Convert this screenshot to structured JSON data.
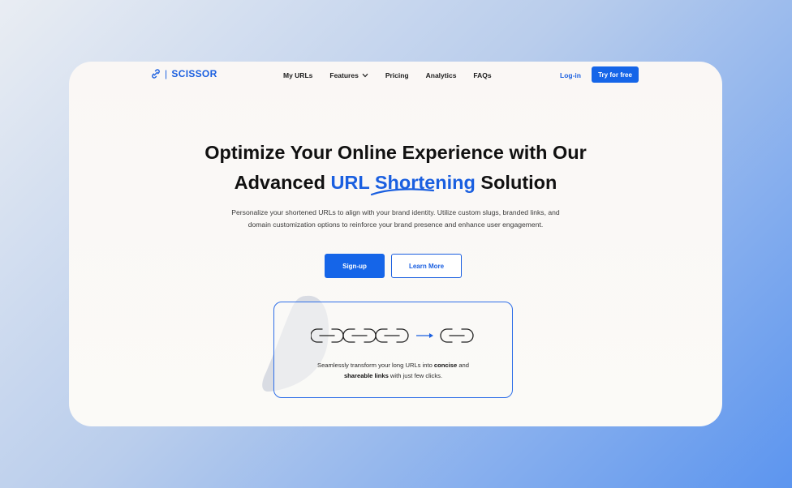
{
  "brand": {
    "name": "SCISSOR",
    "separator": "|"
  },
  "nav": {
    "items": [
      "My URLs",
      "Features",
      "Pricing",
      "Analytics",
      "FAQs"
    ],
    "login": "Log-in",
    "cta": "Try for free"
  },
  "hero": {
    "line1": "Optimize Your Online Experience with Our",
    "line2_pre": "Advanced ",
    "line2_highlight": "URL Shortening",
    "line2_post": " Solution",
    "description": "Personalize your shortened URLs to align with your brand identity. Utilize custom slugs, branded links, and domain customization options to reinforce your brand presence and enhance user engagement.",
    "signup": "Sign-up",
    "learn_more": "Learn More"
  },
  "feature": {
    "text_a": "Seamlessly transform your long URLs into ",
    "text_b": "concise",
    "text_c": " and ",
    "text_d": "shareable links",
    "text_e": " with just few clicks."
  },
  "colors": {
    "accent": "#1565e8",
    "text": "#111111"
  }
}
